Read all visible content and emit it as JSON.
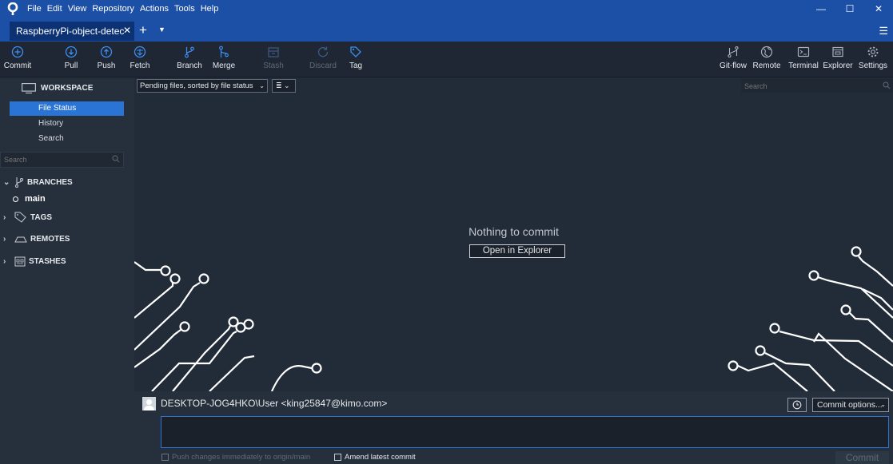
{
  "window": {
    "menu": [
      "File",
      "Edit",
      "View",
      "Repository",
      "Actions",
      "Tools",
      "Help"
    ],
    "controls": {
      "minimize": "—",
      "maximize": "☐",
      "close": "✕"
    },
    "tab": {
      "label": "RaspberryPi-object-detec",
      "close": "✕"
    },
    "new_tab": "+",
    "tab_dropdown": "▼",
    "menu_button": "☰"
  },
  "toolbar": {
    "commit": "Commit",
    "pull": "Pull",
    "push": "Push",
    "fetch": "Fetch",
    "branch": "Branch",
    "merge": "Merge",
    "stash": "Stash",
    "discard": "Discard",
    "tag": "Tag",
    "gitflow": "Git-flow",
    "remote": "Remote",
    "terminal": "Terminal",
    "explorer": "Explorer",
    "settings": "Settings"
  },
  "sidebar": {
    "workspace": "WORKSPACE",
    "items": [
      "File Status",
      "History",
      "Search"
    ],
    "active_item": "File Status",
    "search_placeholder": "Search",
    "branches": "BRANCHES",
    "branch_main": "main",
    "tags": "TAGS",
    "remotes": "REMOTES",
    "stashes": "STASHES"
  },
  "main": {
    "filter": "Pending files, sorted by file status",
    "filter_arrow": "⌄",
    "view_mode": "≣ ⌄",
    "search_placeholder": "Search",
    "empty_message": "Nothing to commit",
    "open_button": "Open in Explorer"
  },
  "commit": {
    "author": "DESKTOP-JOG4HKO\\User <king25847@kimo.com>",
    "options": "Commit options...",
    "options_arrow": "⌄",
    "push_option": "Push changes immediately to origin/main",
    "amend_option": "Amend latest commit",
    "commit_button": "Commit"
  },
  "colors": {
    "titlebar": "#1c4fa6",
    "accent": "#2a74d6",
    "background": "#222b38",
    "sidebar": "#26303d"
  }
}
